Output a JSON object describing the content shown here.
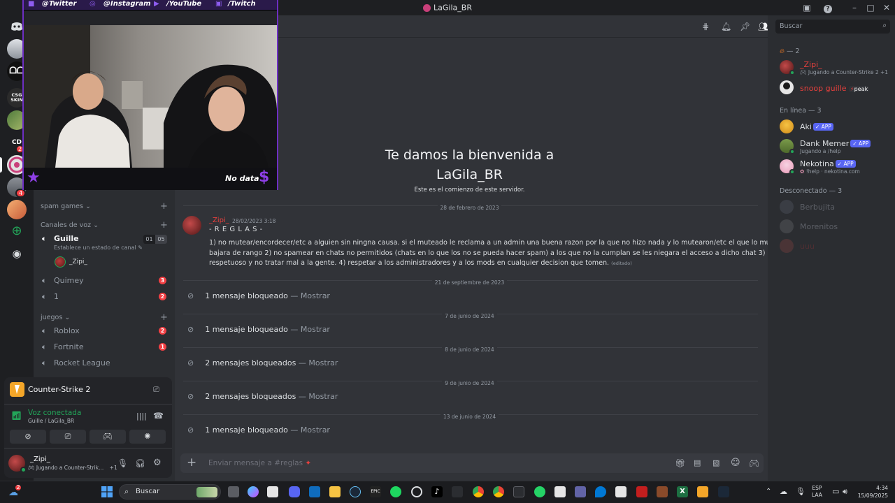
{
  "window": {
    "title": "LaGila_BR"
  },
  "overlay": {
    "socials": [
      "@Twitter",
      "@Instagram",
      "/YouTube",
      "/Twitch"
    ],
    "bottom_text": "No data",
    "dollar": "$"
  },
  "sidebar": {
    "categories": {
      "spam": "spam games",
      "voice": "Canales de voz",
      "games": "juegos"
    },
    "voice_channels": [
      {
        "name": "Guille",
        "count_a": "01",
        "count_b": "05",
        "status": "Establece un estado de canal",
        "member": "_Zipi_"
      },
      {
        "name": "Quimey",
        "badge": "3"
      },
      {
        "name": "1",
        "badge": "2"
      }
    ],
    "game_channels": [
      {
        "name": "Roblox",
        "badge": "2"
      },
      {
        "name": "Fortnite",
        "badge": "1"
      },
      {
        "name": "Rocket League"
      }
    ]
  },
  "game_activity": {
    "name": "Counter-Strike 2"
  },
  "voice_status": {
    "label": "Voz conectada",
    "location": "Guille / LaGila_BR"
  },
  "current_user": {
    "name": "_Zipi_",
    "activity": "Jugando a Counter-Strik...",
    "extra": "+1"
  },
  "welcome": {
    "title_line1": "Te damos la bienvenida a",
    "title_line2": "LaGila_BR",
    "subtitle": "Este es el comienzo de este servidor."
  },
  "messages": {
    "date1": "28 de febrero de 2023",
    "author": "_Zipi_",
    "timestamp": "28/02/2023 3:18",
    "heading": "- R E G L A S -",
    "line1": "1) no mutear/encordecer/etc a alguien sin ningna causa. si el muteado le reclama a un admin una buena razon por la que no hizo nada y lo mutearon/etc el que lo muteo",
    "line2": "bajara de rango   2) no spamear en chats no permitidos (chats en lo que los no se pueda hacer spam) a los que no la cumplan se les niegara el acceso a dicho chat   3)  ser",
    "line3": "respetuoso y no tratar mal a la gente.  4) respetar a los administradores y a los mods en cualquier decision que tomen.",
    "edited": "(editado)",
    "blocked": [
      {
        "date": "21 de septiembre de 2023",
        "text": "1 mensaje bloqueado",
        "dash": " — ",
        "show": "Mostrar"
      },
      {
        "date": "7 de junio de 2024",
        "text": "1 mensaje bloqueado",
        "dash": " — ",
        "show": "Mostrar"
      },
      {
        "date": "8 de junio de 2024",
        "text": "2 mensajes bloqueados",
        "dash": " — ",
        "show": "Mostrar"
      },
      {
        "date": "9 de junio de 2024",
        "text": "2 mensajes bloqueados",
        "dash": " — ",
        "show": "Mostrar"
      },
      {
        "date": "13 de junio de 2024",
        "text": "1 mensaje bloqueado",
        "dash": " — ",
        "show": "Mostrar"
      }
    ]
  },
  "composer": {
    "placeholder": "Enviar mensaje a #reglas"
  },
  "members": {
    "search_placeholder": "Buscar",
    "group1_label": "— 2",
    "group1": [
      {
        "name": "_Zipi_",
        "activity": "Jugando a Counter-Strike 2",
        "extra": "+1"
      },
      {
        "name": "snoop guille",
        "tag": "peak"
      }
    ],
    "online_label": "En línea — 3",
    "online": [
      {
        "name": "Aki",
        "badge": "APP"
      },
      {
        "name": "Dank Memer",
        "badge": "APP",
        "activity": "Jugando a /help"
      },
      {
        "name": "Nekotina",
        "badge": "APP",
        "activity": "!help · nekotina.com"
      }
    ],
    "offline_label": "Desconectado — 3",
    "offline": [
      {
        "name": "Berbujita"
      },
      {
        "name": "Morenitos"
      },
      {
        "name": "uuu"
      }
    ]
  },
  "taskbar": {
    "search_label": "Buscar",
    "badge_left": "2",
    "lang": "ESP",
    "layout": "LAA",
    "time": "4:34",
    "date": "15/09/2025"
  },
  "colors": {
    "accent": "#5865f2",
    "online": "#23a559",
    "danger": "#f23f43",
    "zipi_name": "#e8403d",
    "overlay_purple": "#7a35d8"
  }
}
